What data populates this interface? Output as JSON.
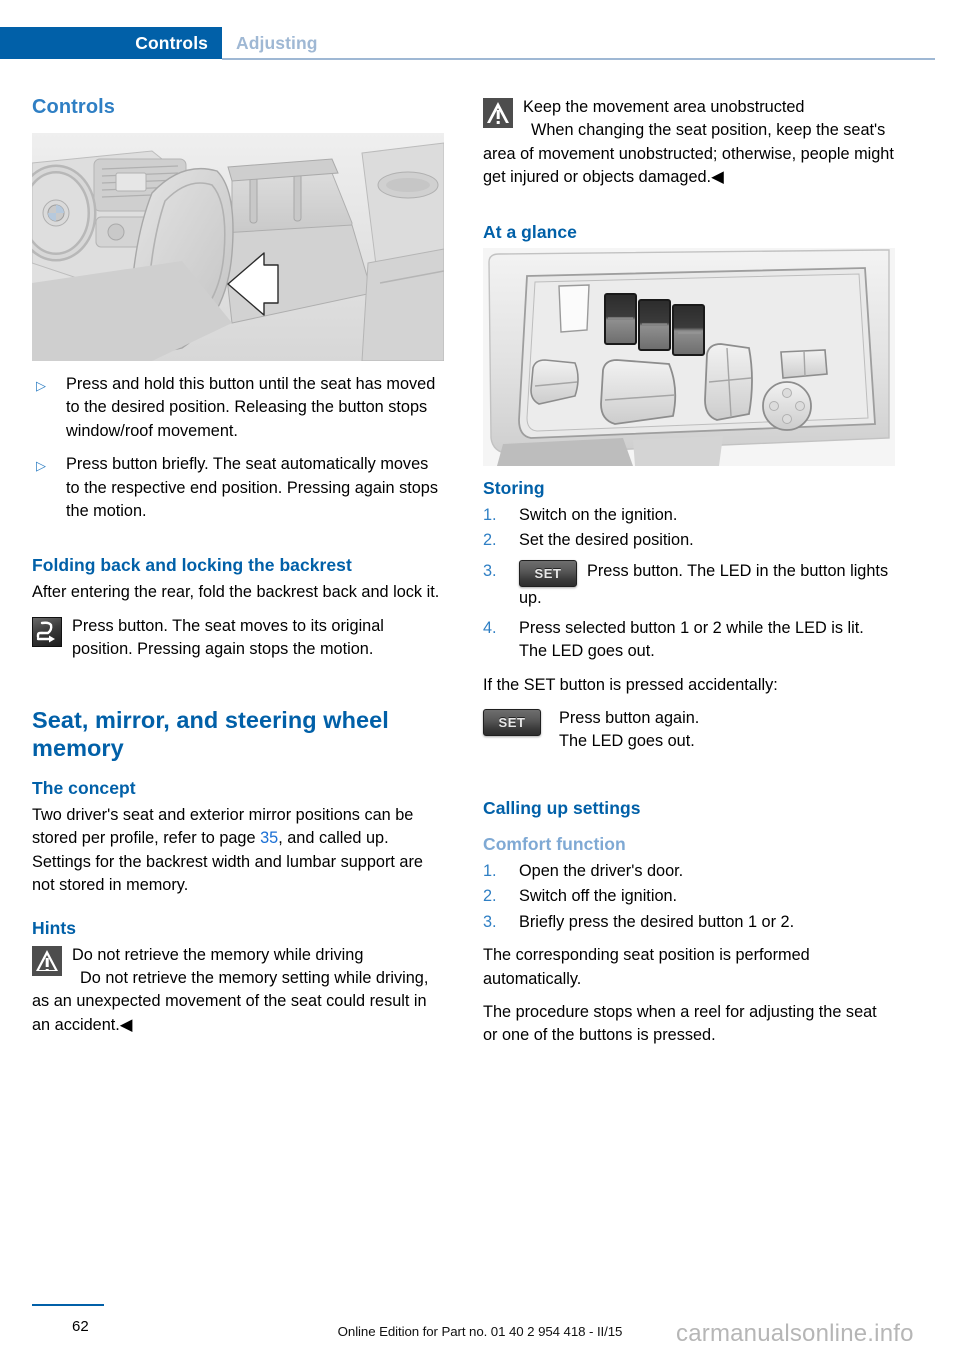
{
  "header": {
    "active_tab": "Controls",
    "inactive_tab": "Adjusting"
  },
  "left_column": {
    "chapter_title": "Controls",
    "figure_caption": "seat-backrest-release-button-illustration",
    "bullets": [
      "Press and hold this button until the seat has moved to the desired position. Releasing the button stops window/roof movement.",
      "Press button briefly. The seat automatically moves to the respective end position. Pressing again stops the motion."
    ],
    "folding": {
      "heading": "Folding back and locking the backrest",
      "intro": "After entering the rear, fold the backrest back and lock it.",
      "icon_note": "Press button. The seat moves to its original position. Pressing again stops the motion."
    },
    "memory": {
      "heading": "Seat, mirror, and steering wheel memory",
      "concept_heading": "The concept",
      "concept_part1": "Two driver's seat and exterior mirror positions can be stored per profile, refer to page ",
      "concept_page_ref": "35",
      "concept_part2": ", and called up. Settings for the backrest width and lumbar support are not stored in memory.",
      "hints_heading": "Hints",
      "hint_title": "Do not retrieve the memory while driving",
      "hint_body": "Do not retrieve the memory setting while driving, as an unexpected movement of the seat could result in an accident.◀"
    }
  },
  "right_column": {
    "warning": {
      "title": "Keep the movement area unobstructed",
      "body": "When changing the seat position, keep the seat's area of movement unobstructed; otherwise, people might get injured or objects damaged.◀"
    },
    "at_a_glance_heading": "At a glance",
    "figure_caption": "seat-memory-control-panel-illustration",
    "storing": {
      "heading": "Storing",
      "steps": [
        {
          "num": "1.",
          "text": "Switch on the ignition."
        },
        {
          "num": "2.",
          "text": "Set the desired position."
        },
        {
          "num": "3.",
          "text": "Press button. The LED in the button lights up.",
          "icon_label": "SET"
        },
        {
          "num": "4.",
          "text": "Press selected button 1 or 2 while the LED is lit. The LED goes out."
        }
      ],
      "accidental_intro": "If the SET button is pressed accidentally:",
      "accidental_icon_label": "SET",
      "accidental_line1": "Press button again.",
      "accidental_line2": "The LED goes out."
    },
    "calling_up": {
      "heading": "Calling up settings",
      "comfort_heading": "Comfort function",
      "steps": [
        {
          "num": "1.",
          "text": "Open the driver's door."
        },
        {
          "num": "2.",
          "text": "Switch off the ignition."
        },
        {
          "num": "3.",
          "text": "Briefly press the desired button 1 or 2."
        }
      ],
      "para1": "The corresponding seat position is performed automatically.",
      "para2": "The procedure stops when a reel for adjusting the seat or one of the buttons is pressed."
    }
  },
  "footer": {
    "page_number": "62",
    "edition_text": "Online Edition for Part no. 01 40 2 954 418 - II/15",
    "watermark": "carmanualsonline.info"
  },
  "colors": {
    "header_blue": "#0160a8",
    "heading_blue": "#0160a8",
    "chapter_blue": "#2f7fc4",
    "light_blue": "#7fa9d4",
    "link_blue": "#1a6fd4"
  }
}
